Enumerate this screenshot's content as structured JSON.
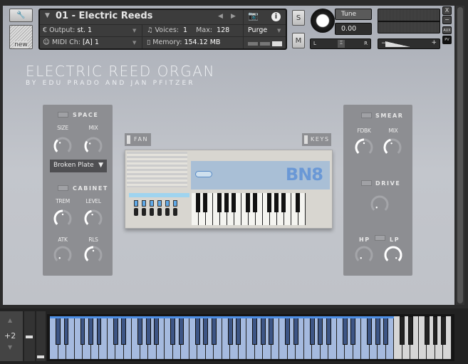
{
  "header": {
    "instrument_name": "01 - Electric Reeds",
    "output_label": "Output:",
    "output_value": "st. 1",
    "voices_label": "Voices:",
    "voices_value": "1",
    "max_label": "Max:",
    "max_value": "128",
    "purge_label": "Purge",
    "midi_label": "MIDI Ch:",
    "midi_value": "[A]  1",
    "memory_label": "Memory:",
    "memory_value": "154.12 MB",
    "new_label": "new",
    "solo": "S",
    "mute": "M",
    "tune_label": "Tune",
    "tune_value": "0.00",
    "pan_left": "L",
    "pan_right": "R",
    "vol_minus": "−",
    "vol_plus": "+",
    "close": "X",
    "minimize": "−",
    "aux": "AUX",
    "pv": "PV"
  },
  "instrument": {
    "title": "ELECTRIC REED ORGAN",
    "subtitle": "BY EDU PRADO AND JAN PFITZER",
    "organ_badge": "BN8",
    "fan_label": "FAN",
    "keys_label": "KEYS"
  },
  "left_panel": {
    "space_label": "SPACE",
    "size_label": "SIZE",
    "mix_label": "MIX",
    "reverb_type": "Broken Plate",
    "cabinet_label": "CABINET",
    "trem_label": "TREM",
    "level_label": "LEVEL",
    "atk_label": "ATK",
    "rls_label": "RLS"
  },
  "right_panel": {
    "smear_label": "SMEAR",
    "fdbk_label": "FDBK",
    "mix_label": "MIX",
    "drive_label": "DRIVE",
    "hp_label": "HP",
    "lp_label": "LP"
  },
  "knob_values": {
    "size": 0.35,
    "mix": 0.3,
    "trem": 0.5,
    "level": 0.45,
    "atk": 0,
    "rls": 0.5,
    "fdbk": 0.5,
    "smear_mix": 0.45,
    "drive": 0,
    "hp": 0,
    "lp": 1
  },
  "keyboard": {
    "octave": "+2",
    "white_keys": 49,
    "active_white_keys": 42
  }
}
